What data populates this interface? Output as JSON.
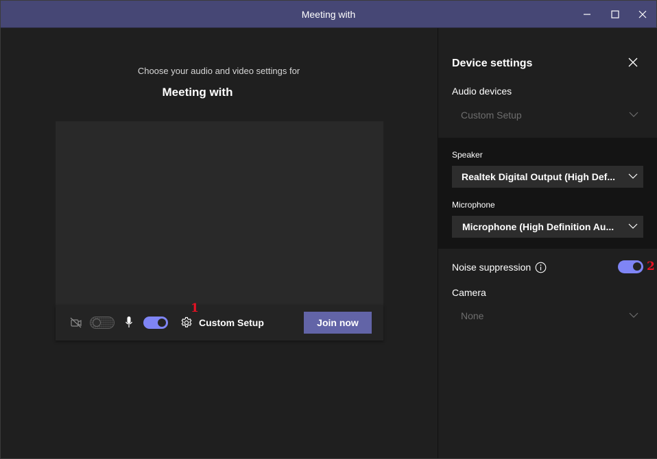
{
  "window": {
    "title": "Meeting with"
  },
  "main": {
    "subtitle": "Choose your audio and video settings for",
    "meeting_title": "Meeting with",
    "controls": {
      "custom_setup_label": "Custom Setup",
      "join_label": "Join now"
    },
    "annotation_1": "1"
  },
  "panel": {
    "title": "Device settings",
    "audio_devices_label": "Audio devices",
    "audio_devices_value": "Custom Setup",
    "speaker_label": "Speaker",
    "speaker_value": "Realtek Digital Output (High Def...",
    "microphone_label": "Microphone",
    "microphone_value": "Microphone (High Definition Au...",
    "noise_suppression_label": "Noise suppression",
    "camera_label": "Camera",
    "camera_value": "None",
    "annotation_2": "2"
  },
  "colors": {
    "titlebar": "#464775",
    "accent": "#7f85f5",
    "join_button": "#6264a7",
    "annotation": "#e81123"
  },
  "icons": [
    "minimize-icon",
    "maximize-icon",
    "close-icon",
    "camera-off-icon",
    "microphone-icon",
    "gear-icon",
    "chevron-down-icon",
    "info-icon"
  ]
}
